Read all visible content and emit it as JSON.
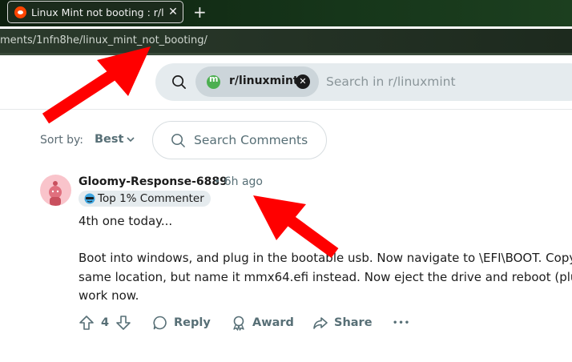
{
  "browser": {
    "tab_title": "Linux Mint not booting : r/l",
    "tab_close": "✕",
    "new_tab": "+",
    "url": "ments/1nfn8he/linux_mint_not_booting/"
  },
  "header": {
    "subreddit_chip": "r/linuxmint",
    "search_placeholder": "Search in r/linuxmint"
  },
  "sort": {
    "label": "Sort by:",
    "value": "Best",
    "search_comments_placeholder": "Search Comments"
  },
  "comment": {
    "author": "Gloomy-Response-6889",
    "time": "• 6h ago",
    "flair": "Top 1% Commenter",
    "paragraph1": "4th one today...",
    "paragraph2_lines": [
      "Boot into windows, and plug in the bootable usb. Now navigate to \\EFI\\BOOT. Copy",
      "same location, but name it mmx64.efi instead. Now eject the drive and reboot (plug",
      "work now."
    ],
    "vote_count": "4",
    "reply_label": "Reply",
    "award_label": "Award",
    "share_label": "Share",
    "more_label": "•••"
  },
  "colors": {
    "annotation_arrow": "#ff0000",
    "reddit_orange": "#ff4500",
    "meta_gray": "#576f76"
  }
}
